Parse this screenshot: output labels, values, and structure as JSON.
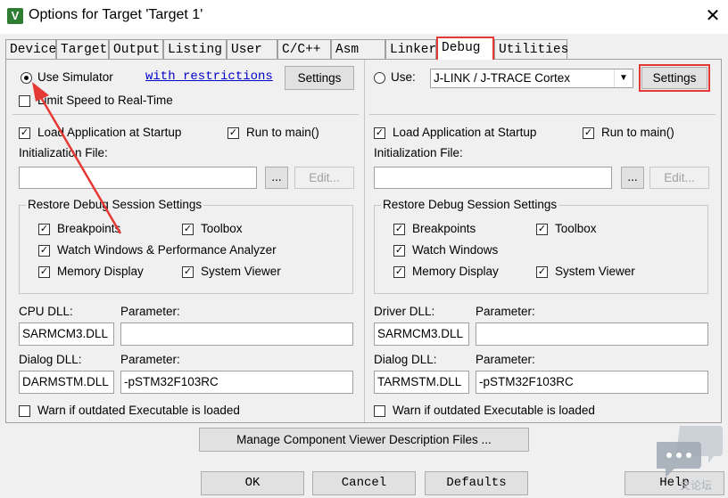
{
  "window": {
    "title": "Options for Target 'Target 1'",
    "close_label": "✕",
    "icon_letter": "V"
  },
  "tabs": [
    "Device",
    "Target",
    "Output",
    "Listing",
    "User",
    "C/C++",
    "Asm",
    "Linker",
    "Debug",
    "Utilities"
  ],
  "active_tab": "Debug",
  "left": {
    "use_simulator": "Use Simulator",
    "with_restrictions": "with restrictions",
    "settings": "Settings",
    "limit_speed": "Limit Speed to Real-Time",
    "load_app": "Load Application at Startup",
    "run_to_main": "Run to main()",
    "init_file_label": "Initialization File:",
    "init_file_value": "",
    "browse": "...",
    "edit": "Edit...",
    "restore_group": "Restore Debug Session Settings",
    "breakpoints": "Breakpoints",
    "toolbox": "Toolbox",
    "watch_windows": "Watch Windows & Performance Analyzer",
    "memory_display": "Memory Display",
    "system_viewer": "System Viewer",
    "dll_label": "CPU DLL:",
    "dll_param_label": "Parameter:",
    "dll_value": "SARMCM3.DLL",
    "dll_param_value": "",
    "dialog_label": "Dialog DLL:",
    "dialog_param_label": "Parameter:",
    "dialog_value": "DARMSTM.DLL",
    "dialog_param_value": "-pSTM32F103RC",
    "warn": "Warn if outdated Executable is loaded"
  },
  "right": {
    "use": "Use:",
    "debugger": "J-LINK / J-TRACE Cortex",
    "settings": "Settings",
    "load_app": "Load Application at Startup",
    "run_to_main": "Run to main()",
    "init_file_label": "Initialization File:",
    "init_file_value": "",
    "browse": "...",
    "edit": "Edit...",
    "restore_group": "Restore Debug Session Settings",
    "breakpoints": "Breakpoints",
    "toolbox": "Toolbox",
    "watch_windows": "Watch Windows",
    "memory_display": "Memory Display",
    "system_viewer": "System Viewer",
    "dll_label": "Driver DLL:",
    "dll_param_label": "Parameter:",
    "dll_value": "SARMCM3.DLL",
    "dll_param_value": "",
    "dialog_label": "Dialog DLL:",
    "dialog_param_label": "Parameter:",
    "dialog_value": "TARMSTM.DLL",
    "dialog_param_value": "-pSTM32F103RC",
    "warn": "Warn if outdated Executable is loaded"
  },
  "manage_button": "Manage Component Viewer Description Files ...",
  "bottom_buttons": {
    "ok": "OK",
    "cancel": "Cancel",
    "defaults": "Defaults",
    "help": "Help"
  },
  "watermark_text": "文论坛",
  "check_glyph": "✓",
  "colors": {
    "highlight": "#e53935",
    "link": "#0000cc",
    "app_icon": "#2e7d32"
  }
}
